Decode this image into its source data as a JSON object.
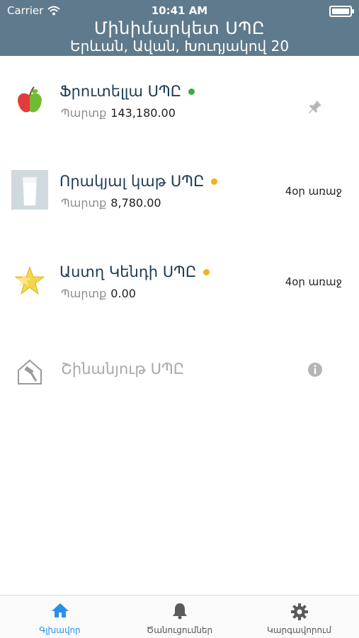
{
  "status_bar": {
    "carrier": "Carrier",
    "time": "10:41 AM"
  },
  "header": {
    "title": "Մինիմարկետ ՍՊԸ",
    "subtitle": "Երևան, Ավան, Խուդյակով 20"
  },
  "suppliers": [
    {
      "name": "Ֆրուտելլա ՍՊԸ",
      "balance_label": "Պարտք",
      "balance": "143,180.00",
      "status_color": "#3caa3c",
      "right_text": "",
      "icon": "apple-icon"
    },
    {
      "name": "Որակյալ կաթ ՍՊԸ",
      "balance_label": "Պարտք",
      "balance": "8,780.00",
      "status_color": "#f2b21b",
      "right_text": "4օր առաջ",
      "icon": "milk-glass-icon"
    },
    {
      "name": "Աստղ Կենդի ՍՊԸ",
      "balance_label": "Պարտք",
      "balance": "0.00",
      "status_color": "#f2b21b",
      "right_text": "4օր առաջ",
      "icon": "candy-star-icon"
    },
    {
      "name": "Շինանյութ ՍՊԸ",
      "icon": "house-hammer-icon",
      "right_icon": "info-icon"
    }
  ],
  "tabs": [
    {
      "label": "Գլխավոր",
      "icon": "home-icon",
      "active": true,
      "color": "#2a8fe8"
    },
    {
      "label": "Ծանուցումներ",
      "icon": "bell-icon",
      "active": false
    },
    {
      "label": "Կարգավորում",
      "icon": "gear-icon",
      "active": false
    }
  ]
}
